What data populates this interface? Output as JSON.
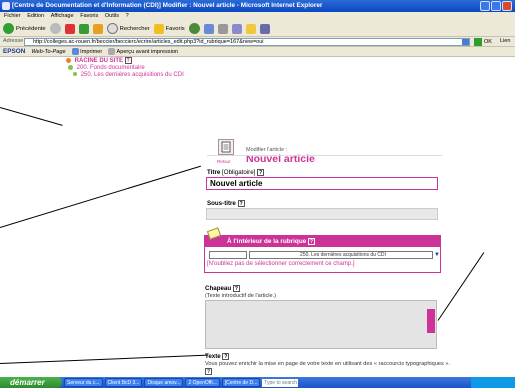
{
  "window": {
    "title": "[Centre de Documentation et d'Information (CDI)] Modifier : Nouvel article - Microsoft Internet Explorer"
  },
  "menu": [
    "Fichier",
    "Edition",
    "Affichage",
    "Favoris",
    "Outils",
    "?"
  ],
  "toolbar": {
    "back_label": "Précédente",
    "search_label": "Rechercher",
    "favorites_label": "Favoris"
  },
  "address": {
    "label": "Adresse",
    "url": "http://colleges.ac-rouen.fr/beccier/beccierc/ecrire/articles_edit.php3?id_rubrique=167&new=oui",
    "ok_label": "OK",
    "links_label": "Lien"
  },
  "epson": {
    "brand": "EPSON",
    "webtopage": "Web-To-Page",
    "print_label": "Imprimer",
    "preview_label": "Aperçu avant impression"
  },
  "breadcrumb": {
    "root": "RACINE DU SITE",
    "level1": "200. Fonds documentaire",
    "level2": "250. Les dernières acquisitions du CDI"
  },
  "header": {
    "back_label": "Retour",
    "modify_label": "Modifier l'article :",
    "title": "Nouvel article"
  },
  "form": {
    "titre_label": "Titre",
    "titre_required": "[Obligatoire]",
    "titre_value": "Nouvel article",
    "soustitre_label": "Sous-titre",
    "rubrique_header": "À l'intérieur de la rubrique",
    "rubrique_value": "250. Les dernières acquisitions du CDI",
    "rubrique_warning": "[N'oubliez pas de sélectionner correctement ce champ.]",
    "chapeau_label": "Chapeau",
    "chapeau_help": "(Texte introductif de l'article.)",
    "texte_label": "Texte",
    "texte_help": "Vous pouvez enrichir la mise en page de votre texte en utilisant des « raccourcis typographiques »."
  },
  "taskbar": {
    "start_label": "démarrer",
    "tasks": [
      "Serveur du c...",
      "Client BcD 3...",
      "Disque amov...",
      "2 OpenOffi...",
      "[Centre de D..."
    ],
    "search_placeholder": "Type to search"
  },
  "colors": {
    "accent": "#cc3399",
    "title_bar": "#0a48c0"
  }
}
